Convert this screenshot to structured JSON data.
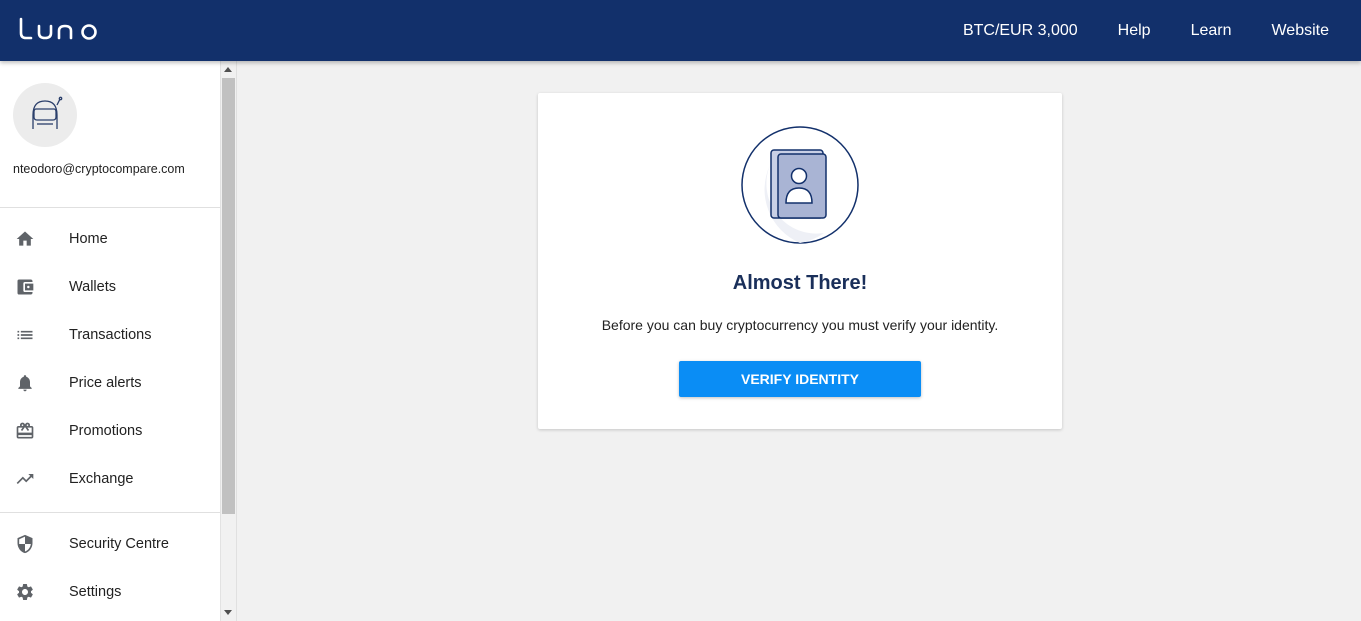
{
  "brand": {
    "logo_text": "LUNO"
  },
  "topbar": {
    "price": "BTC/EUR 3,000",
    "links": [
      "Help",
      "Learn",
      "Website"
    ]
  },
  "user": {
    "email": "nteodoro@cryptocompare.com"
  },
  "sidebar": {
    "items": [
      {
        "label": "Home",
        "icon": "home-icon"
      },
      {
        "label": "Wallets",
        "icon": "wallet-icon"
      },
      {
        "label": "Transactions",
        "icon": "list-icon"
      },
      {
        "label": "Price alerts",
        "icon": "bell-icon"
      },
      {
        "label": "Promotions",
        "icon": "gift-card-icon"
      },
      {
        "label": "Exchange",
        "icon": "trending-up-icon"
      }
    ],
    "secondary": [
      {
        "label": "Security Centre",
        "icon": "shield-icon"
      },
      {
        "label": "Settings",
        "icon": "gear-icon"
      }
    ]
  },
  "card": {
    "title": "Almost There!",
    "text": "Before you can buy cryptocurrency you must verify your identity.",
    "button_label": "VERIFY IDENTITY"
  },
  "colors": {
    "topbar": "#12306b",
    "accent": "#0a8df5",
    "title": "#1a2f5a"
  }
}
